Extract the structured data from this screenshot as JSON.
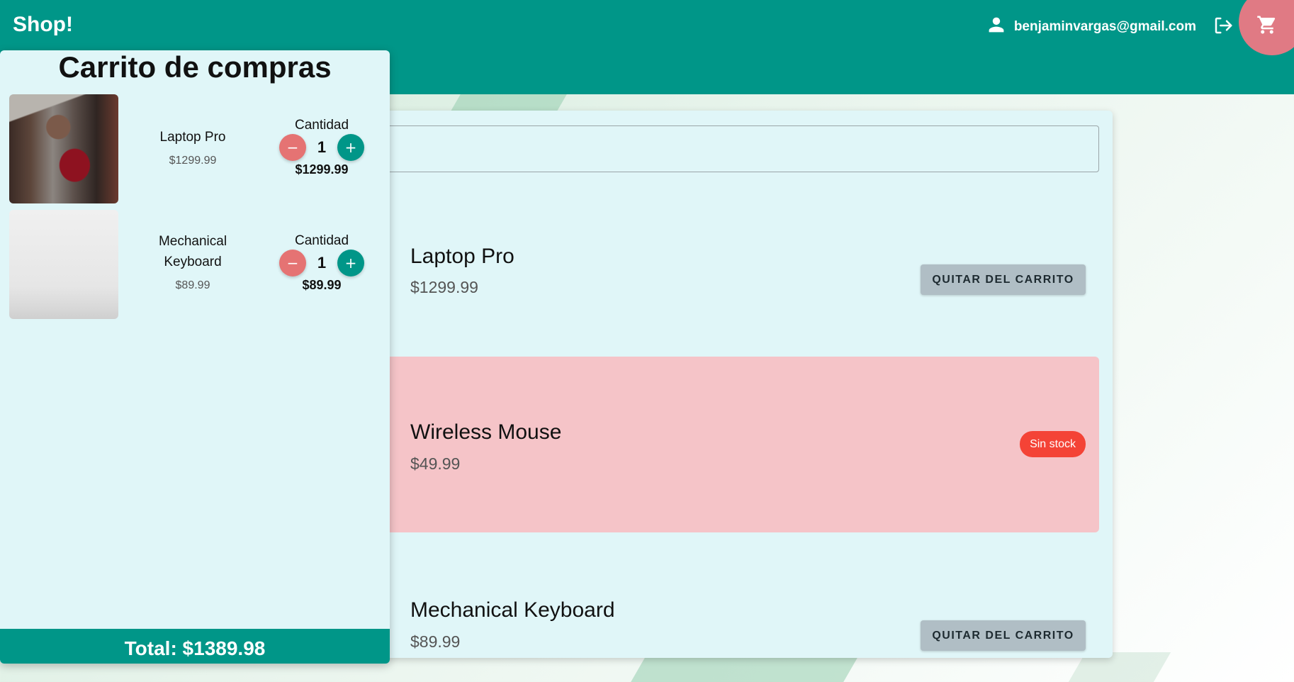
{
  "app": {
    "brand": "Shop!"
  },
  "header": {
    "user_email": "benjaminvargas@gmail.com",
    "icons": {
      "user": "user-icon",
      "logout": "logout-icon",
      "cart": "cart-icon"
    },
    "colors": {
      "appbar": "#009688",
      "cart_fab": "#e07a84"
    }
  },
  "search": {
    "value": "",
    "placeholder": ""
  },
  "products": [
    {
      "name": "Laptop Pro",
      "price": "$1299.99",
      "action_label": "QUITAR DEL CARRITO",
      "in_stock": true
    },
    {
      "name": "Wireless Mouse",
      "price": "$49.99",
      "status_label": "Sin stock",
      "in_stock": false
    },
    {
      "name": "Mechanical Keyboard",
      "price": "$89.99",
      "action_label": "QUITAR DEL CARRITO",
      "in_stock": true
    }
  ],
  "cart": {
    "title": "Carrito de compras",
    "items": [
      {
        "name": "Laptop Pro",
        "price": "$1299.99",
        "qty_label": "Cantidad",
        "qty": "1",
        "subtotal": "$1299.99",
        "minus": "−",
        "plus": "+"
      },
      {
        "name": "Mechanical Keyboard",
        "price": "$89.99",
        "qty_label": "Cantidad",
        "qty": "1",
        "subtotal": "$89.99",
        "minus": "−",
        "plus": "+"
      }
    ],
    "total": "Total: $1389.98"
  },
  "colors": {
    "primary": "#009688",
    "out_of_stock_bg": "#f5c4c8",
    "badge": "#f44336",
    "remove_btn": "#b0bec5",
    "panel_bg": "#e0f6f8"
  }
}
